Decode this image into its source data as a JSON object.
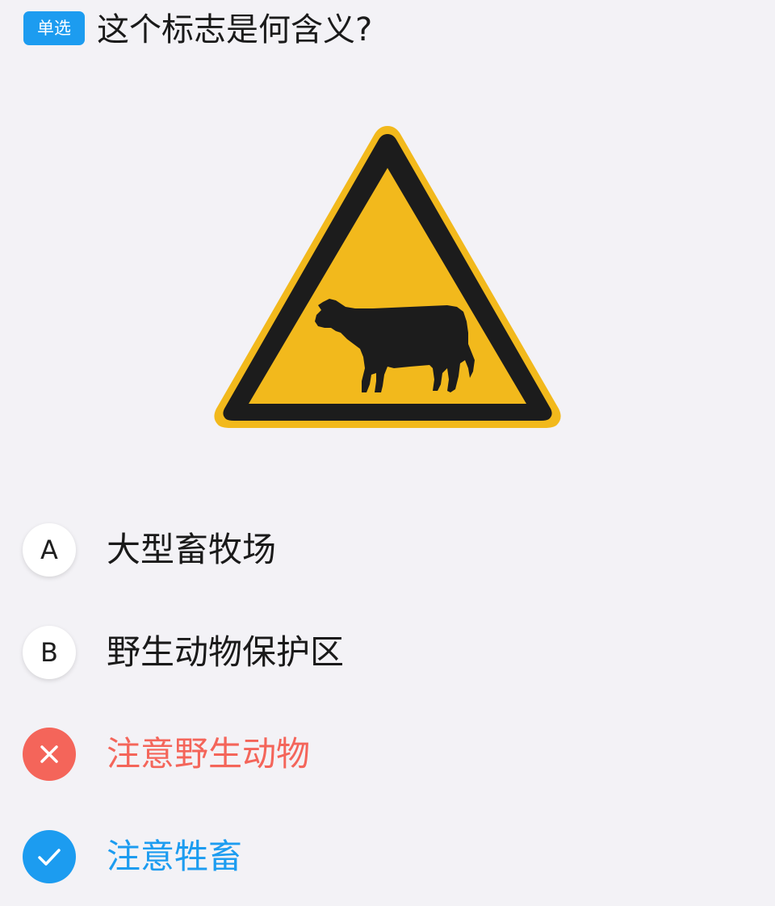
{
  "question": {
    "type_tag": "单选",
    "text": "这个标志是何含义?"
  },
  "sign": {
    "icon": "cattle-warning-sign",
    "colors": {
      "fill": "#f2b91c",
      "border": "#1c1c1c"
    }
  },
  "options": [
    {
      "letter": "A",
      "text": "大型畜牧场",
      "state": "default"
    },
    {
      "letter": "B",
      "text": "野生动物保护区",
      "state": "default"
    },
    {
      "letter": "",
      "text": "注意野生动物",
      "state": "wrong",
      "icon": "close-icon"
    },
    {
      "letter": "",
      "text": "注意牲畜",
      "state": "correct",
      "icon": "check-icon"
    }
  ],
  "colors": {
    "accent": "#1c9cf0",
    "wrong": "#f4655a",
    "text": "#1a1a1a",
    "background": "#f3f2f6"
  }
}
